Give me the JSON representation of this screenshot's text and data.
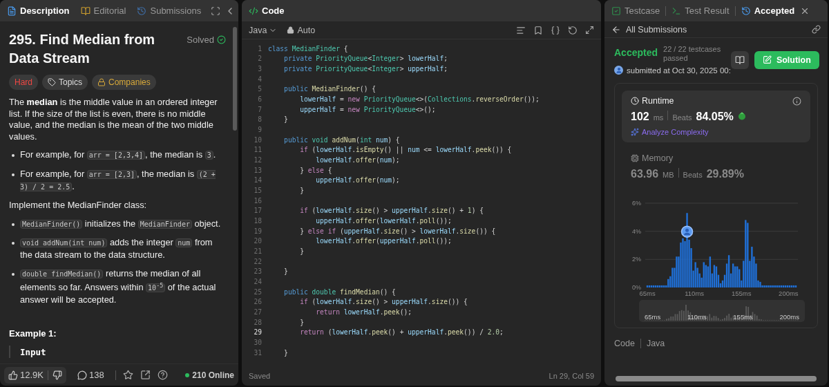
{
  "left_panel": {
    "tabs": [
      {
        "label": "Description",
        "selected": true
      },
      {
        "label": "Editorial",
        "selected": false
      },
      {
        "label": "Submissions",
        "selected": false
      }
    ],
    "title": "295. Find Median from Data Stream",
    "status": "Solved",
    "tags": [
      {
        "kind": "difficulty",
        "label": "Hard"
      },
      {
        "kind": "topics",
        "label": "Topics"
      },
      {
        "kind": "companies",
        "label": "Companies"
      }
    ],
    "blocks": [
      {
        "kind": "para",
        "segments": [
          {
            "kind": "text",
            "text": "The **median** is the middle value in an ordered integer list. If the size of the list is even, there is no middle value, and the median is the mean of the two middle values."
          }
        ]
      },
      {
        "kind": "bullet",
        "segments": [
          {
            "kind": "text",
            "text": "For example, for "
          },
          {
            "kind": "code",
            "text": "arr = [2,3,4]"
          },
          {
            "kind": "text",
            "text": ", the median is "
          },
          {
            "kind": "code",
            "text": "3"
          },
          {
            "kind": "text",
            "text": "."
          }
        ]
      },
      {
        "kind": "bullet",
        "segments": [
          {
            "kind": "text",
            "text": "For example, for "
          },
          {
            "kind": "code",
            "text": "arr = [2,3]"
          },
          {
            "kind": "text",
            "text": ", the median is "
          },
          {
            "kind": "code",
            "text": "(2 + 3) / 2 = 2.5"
          },
          {
            "kind": "text",
            "text": "."
          }
        ]
      },
      {
        "kind": "para",
        "segments": [
          {
            "kind": "text",
            "text": "Implement the MedianFinder class:"
          }
        ]
      },
      {
        "kind": "bullet",
        "segments": [
          {
            "kind": "code",
            "text": "MedianFinder()"
          },
          {
            "kind": "text",
            "text": " initializes the "
          },
          {
            "kind": "code",
            "text": "MedianFinder"
          },
          {
            "kind": "text",
            "text": " object."
          }
        ]
      },
      {
        "kind": "bullet",
        "segments": [
          {
            "kind": "code",
            "text": "void addNum(int num)"
          },
          {
            "kind": "text",
            "text": " adds the integer "
          },
          {
            "kind": "code",
            "text": "num"
          },
          {
            "kind": "text",
            "text": " from the data stream to the data structure."
          }
        ]
      },
      {
        "kind": "bullet",
        "segments": [
          {
            "kind": "code",
            "text": "double findMedian()"
          },
          {
            "kind": "text",
            "text": " returns the median of all elements so far. Answers within "
          },
          {
            "kind": "code",
            "text": "10$^{-5}$"
          },
          {
            "kind": "text",
            "text": " of the actual answer will be accepted."
          }
        ]
      }
    ],
    "example_heading": "Example 1:",
    "example_label": "Input",
    "footer": {
      "likes": "12.9K",
      "comments": "138",
      "online": "210 Online"
    }
  },
  "code_panel": {
    "title": "Code",
    "language": "Java",
    "mode": "Auto",
    "lines": [
      {
        "number": "1",
        "current": false,
        "tokens": [
          {
            "kind": "b",
            "text": "class "
          },
          {
            "kind": "t",
            "text": "MedianFinder"
          },
          {
            "kind": "p",
            "text": " {"
          }
        ]
      },
      {
        "number": "2",
        "current": false,
        "tokens": [
          {
            "kind": "b",
            "text": "    private "
          },
          {
            "kind": "t",
            "text": "PriorityQueue"
          },
          {
            "kind": "p",
            "text": "<"
          },
          {
            "kind": "t",
            "text": "Integer"
          },
          {
            "kind": "p",
            "text": "> "
          },
          {
            "kind": "v",
            "text": "lowerHalf"
          },
          {
            "kind": "p",
            "text": ";"
          }
        ]
      },
      {
        "number": "3",
        "current": false,
        "tokens": [
          {
            "kind": "b",
            "text": "    private "
          },
          {
            "kind": "t",
            "text": "PriorityQueue"
          },
          {
            "kind": "p",
            "text": "<"
          },
          {
            "kind": "t",
            "text": "Integer"
          },
          {
            "kind": "p",
            "text": "> "
          },
          {
            "kind": "v",
            "text": "upperHalf"
          },
          {
            "kind": "p",
            "text": ";"
          }
        ]
      },
      {
        "number": "4",
        "current": false
      },
      {
        "number": "5",
        "current": false,
        "tokens": [
          {
            "kind": "b",
            "text": "    public "
          },
          {
            "kind": "f",
            "text": "MedianFinder"
          },
          {
            "kind": "p",
            "text": "() {"
          }
        ]
      },
      {
        "number": "6",
        "current": false,
        "tokens": [
          {
            "kind": "v",
            "text": "        lowerHalf"
          },
          {
            "kind": "p",
            "text": " = "
          },
          {
            "kind": "k",
            "text": "new "
          },
          {
            "kind": "t",
            "text": "PriorityQueue"
          },
          {
            "kind": "p",
            "text": "<>("
          },
          {
            "kind": "t",
            "text": "Collections"
          },
          {
            "kind": "p",
            "text": "."
          },
          {
            "kind": "f",
            "text": "reverseOrder"
          },
          {
            "kind": "p",
            "text": "());"
          }
        ]
      },
      {
        "number": "7",
        "current": false,
        "tokens": [
          {
            "kind": "v",
            "text": "        upperHalf"
          },
          {
            "kind": "p",
            "text": " = "
          },
          {
            "kind": "k",
            "text": "new "
          },
          {
            "kind": "t",
            "text": "PriorityQueue"
          },
          {
            "kind": "p",
            "text": "<>();"
          }
        ]
      },
      {
        "number": "8",
        "current": false,
        "tokens": [
          {
            "kind": "p",
            "text": "    }"
          }
        ]
      },
      {
        "number": "9",
        "current": false
      },
      {
        "number": "10",
        "current": false,
        "tokens": [
          {
            "kind": "b",
            "text": "    public "
          },
          {
            "kind": "t",
            "text": "void "
          },
          {
            "kind": "f",
            "text": "addNum"
          },
          {
            "kind": "p",
            "text": "("
          },
          {
            "kind": "t",
            "text": "int "
          },
          {
            "kind": "v",
            "text": "num"
          },
          {
            "kind": "p",
            "text": ") {"
          }
        ]
      },
      {
        "number": "11",
        "current": false,
        "tokens": [
          {
            "kind": "k",
            "text": "        if"
          },
          {
            "kind": "p",
            "text": " ("
          },
          {
            "kind": "v",
            "text": "lowerHalf"
          },
          {
            "kind": "p",
            "text": "."
          },
          {
            "kind": "f",
            "text": "isEmpty"
          },
          {
            "kind": "p",
            "text": "() || "
          },
          {
            "kind": "v",
            "text": "num"
          },
          {
            "kind": "p",
            "text": " <= "
          },
          {
            "kind": "v",
            "text": "lowerHalf"
          },
          {
            "kind": "p",
            "text": "."
          },
          {
            "kind": "f",
            "text": "peek"
          },
          {
            "kind": "p",
            "text": "()) {"
          }
        ]
      },
      {
        "number": "12",
        "current": false,
        "tokens": [
          {
            "kind": "v",
            "text": "            lowerHalf"
          },
          {
            "kind": "p",
            "text": "."
          },
          {
            "kind": "f",
            "text": "offer"
          },
          {
            "kind": "p",
            "text": "("
          },
          {
            "kind": "v",
            "text": "num"
          },
          {
            "kind": "p",
            "text": ");"
          }
        ]
      },
      {
        "number": "13",
        "current": false,
        "tokens": [
          {
            "kind": "p",
            "text": "        } "
          },
          {
            "kind": "k",
            "text": "else"
          },
          {
            "kind": "p",
            "text": " {"
          }
        ]
      },
      {
        "number": "14",
        "current": false,
        "tokens": [
          {
            "kind": "v",
            "text": "            upperHalf"
          },
          {
            "kind": "p",
            "text": "."
          },
          {
            "kind": "f",
            "text": "offer"
          },
          {
            "kind": "p",
            "text": "("
          },
          {
            "kind": "v",
            "text": "num"
          },
          {
            "kind": "p",
            "text": ");"
          }
        ]
      },
      {
        "number": "15",
        "current": false,
        "tokens": [
          {
            "kind": "p",
            "text": "        }"
          }
        ]
      },
      {
        "number": "16",
        "current": false
      },
      {
        "number": "17",
        "current": false,
        "tokens": [
          {
            "kind": "k",
            "text": "        if"
          },
          {
            "kind": "p",
            "text": " ("
          },
          {
            "kind": "v",
            "text": "lowerHalf"
          },
          {
            "kind": "p",
            "text": "."
          },
          {
            "kind": "f",
            "text": "size"
          },
          {
            "kind": "p",
            "text": "() > "
          },
          {
            "kind": "v",
            "text": "upperHalf"
          },
          {
            "kind": "p",
            "text": "."
          },
          {
            "kind": "f",
            "text": "size"
          },
          {
            "kind": "p",
            "text": "() + "
          },
          {
            "kind": "n",
            "text": "1"
          },
          {
            "kind": "p",
            "text": ") {"
          }
        ]
      },
      {
        "number": "18",
        "current": false,
        "tokens": [
          {
            "kind": "v",
            "text": "            upperHalf"
          },
          {
            "kind": "p",
            "text": "."
          },
          {
            "kind": "f",
            "text": "offer"
          },
          {
            "kind": "p",
            "text": "("
          },
          {
            "kind": "v",
            "text": "lowerHalf"
          },
          {
            "kind": "p",
            "text": "."
          },
          {
            "kind": "f",
            "text": "poll"
          },
          {
            "kind": "p",
            "text": "());"
          }
        ]
      },
      {
        "number": "19",
        "current": false,
        "tokens": [
          {
            "kind": "p",
            "text": "        } "
          },
          {
            "kind": "k",
            "text": "else if"
          },
          {
            "kind": "p",
            "text": " ("
          },
          {
            "kind": "v",
            "text": "upperHalf"
          },
          {
            "kind": "p",
            "text": "."
          },
          {
            "kind": "f",
            "text": "size"
          },
          {
            "kind": "p",
            "text": "() > "
          },
          {
            "kind": "v",
            "text": "lowerHalf"
          },
          {
            "kind": "p",
            "text": "."
          },
          {
            "kind": "f",
            "text": "size"
          },
          {
            "kind": "p",
            "text": "()) {"
          }
        ]
      },
      {
        "number": "20",
        "current": false,
        "tokens": [
          {
            "kind": "v",
            "text": "            lowerHalf"
          },
          {
            "kind": "p",
            "text": "."
          },
          {
            "kind": "f",
            "text": "offer"
          },
          {
            "kind": "p",
            "text": "("
          },
          {
            "kind": "v",
            "text": "upperHalf"
          },
          {
            "kind": "p",
            "text": "."
          },
          {
            "kind": "f",
            "text": "poll"
          },
          {
            "kind": "p",
            "text": "());"
          }
        ]
      },
      {
        "number": "21",
        "current": false,
        "tokens": [
          {
            "kind": "p",
            "text": "        }"
          }
        ]
      },
      {
        "number": "22",
        "current": false
      },
      {
        "number": "23",
        "current": false,
        "tokens": [
          {
            "kind": "p",
            "text": "    }"
          }
        ]
      },
      {
        "number": "24",
        "current": false
      },
      {
        "number": "25",
        "current": false,
        "tokens": [
          {
            "kind": "b",
            "text": "    public "
          },
          {
            "kind": "t",
            "text": "double "
          },
          {
            "kind": "f",
            "text": "findMedian"
          },
          {
            "kind": "p",
            "text": "() {"
          }
        ]
      },
      {
        "number": "26",
        "current": false,
        "tokens": [
          {
            "kind": "k",
            "text": "        if"
          },
          {
            "kind": "p",
            "text": " ("
          },
          {
            "kind": "v",
            "text": "lowerHalf"
          },
          {
            "kind": "p",
            "text": "."
          },
          {
            "kind": "f",
            "text": "size"
          },
          {
            "kind": "p",
            "text": "() > "
          },
          {
            "kind": "v",
            "text": "upperHalf"
          },
          {
            "kind": "p",
            "text": "."
          },
          {
            "kind": "f",
            "text": "size"
          },
          {
            "kind": "p",
            "text": "()) {"
          }
        ]
      },
      {
        "number": "27",
        "current": false,
        "tokens": [
          {
            "kind": "k",
            "text": "            return "
          },
          {
            "kind": "v",
            "text": "lowerHalf"
          },
          {
            "kind": "p",
            "text": "."
          },
          {
            "kind": "f",
            "text": "peek"
          },
          {
            "kind": "p",
            "text": "();"
          }
        ]
      },
      {
        "number": "28",
        "current": false,
        "tokens": [
          {
            "kind": "p",
            "text": "        }"
          }
        ]
      },
      {
        "number": "29",
        "current": true,
        "tokens": [
          {
            "kind": "k",
            "text": "        return"
          },
          {
            "kind": "p",
            "text": " ("
          },
          {
            "kind": "v",
            "text": "lowerHalf"
          },
          {
            "kind": "p",
            "text": "."
          },
          {
            "kind": "f",
            "text": "peek"
          },
          {
            "kind": "p",
            "text": "() + "
          },
          {
            "kind": "v",
            "text": "upperHalf"
          },
          {
            "kind": "p",
            "text": "."
          },
          {
            "kind": "f",
            "text": "peek"
          },
          {
            "kind": "p",
            "text": "()) / "
          },
          {
            "kind": "n",
            "text": "2.0"
          },
          {
            "kind": "p",
            "text": ";"
          }
        ]
      },
      {
        "number": "30",
        "current": false
      },
      {
        "number": "31",
        "current": false,
        "tokens": [
          {
            "kind": "p",
            "text": "    }"
          }
        ]
      }
    ],
    "status": "Saved",
    "cursor": "Ln 29, Col 59"
  },
  "result_panel": {
    "tabs": [
      {
        "label": "Testcase",
        "selected": false
      },
      {
        "label": "Test Result",
        "selected": false
      },
      {
        "label": "Accepted",
        "selected": true
      }
    ],
    "back_label": "All Submissions",
    "verdict": "Accepted",
    "testcases": "22 / 22 testcases passed",
    "submitted": "submitted at Oct 30, 2025 00:",
    "solution_button": "Solution",
    "metrics": [
      {
        "kind": "runtime",
        "label": "Runtime",
        "value": "102",
        "unit": "ms",
        "beats_label": "Beats",
        "beats": "84.05%",
        "selected": true,
        "link": "Analyze Complexity"
      },
      {
        "kind": "memory",
        "label": "Memory",
        "value": "63.96",
        "unit": "MB",
        "beats_label": "Beats",
        "beats": "29.89%",
        "selected": false
      }
    ],
    "chart_data": {
      "type": "bar",
      "xlim": [
        63,
        209
      ],
      "ylim": [
        0,
        6
      ],
      "x": [
        65,
        67,
        69,
        71,
        73,
        75,
        77,
        79,
        81,
        83,
        85,
        87,
        89,
        91,
        93,
        95,
        97,
        99,
        101,
        103,
        105,
        107,
        109,
        111,
        113,
        115,
        117,
        119,
        121,
        123,
        125,
        127,
        129,
        131,
        133,
        135,
        137,
        139,
        141,
        143,
        145,
        147,
        149,
        151,
        153,
        155,
        157,
        159,
        161,
        163,
        165,
        167,
        169,
        171,
        173,
        175,
        177,
        179,
        181,
        183,
        185,
        187,
        189,
        191,
        193,
        195,
        197,
        199,
        201,
        203,
        205,
        207
      ],
      "series": [
        {
          "color": "#1f6fd6",
          "values": [
            0.15,
            0.15,
            0.15,
            0.15,
            0.15,
            0.15,
            0.15,
            0.15,
            0.15,
            0.15,
            0.6,
            0.8,
            1.4,
            1.4,
            2.2,
            2.2,
            3.2,
            3.5,
            3.3,
            5.3,
            3.4,
            2.8,
            1.2,
            1.8,
            1.4,
            1.0,
            0.7,
            1.8,
            1.6,
            1.5,
            2.2,
            1.0,
            1.6,
            1.5,
            0.9,
            0.3,
            0.5,
            0.9,
            1.7,
            2.3,
            1.0,
            1.7,
            1.5,
            1.5,
            1.3,
            0.5,
            1.9,
            4.8,
            4.6,
            1.9,
            2.9,
            2.2,
            1.7,
            0.5,
            0.4,
            0.15,
            0.15,
            0.15,
            0.15,
            0.15,
            0.15,
            0.15,
            0.15,
            0.15,
            0.15,
            0.15,
            0.15,
            0.15,
            0.15,
            0.15,
            0.15,
            0.15
          ]
        }
      ],
      "xticks": [
        {
          "value": 65,
          "label": "65ms"
        },
        {
          "value": 110,
          "label": "110ms"
        },
        {
          "value": 155,
          "label": "155ms"
        },
        {
          "value": 200,
          "label": "200ms"
        }
      ],
      "yticks": [
        {
          "value": 0,
          "label": "0%"
        },
        {
          "value": 2,
          "label": "2%"
        },
        {
          "value": 4,
          "label": "4%"
        },
        {
          "value": 6,
          "label": "6%"
        }
      ]
    },
    "overview_labels": [
      "65ms",
      "110ms",
      "155ms",
      "200ms"
    ],
    "footer": {
      "label": "Code",
      "language": "Java"
    }
  }
}
